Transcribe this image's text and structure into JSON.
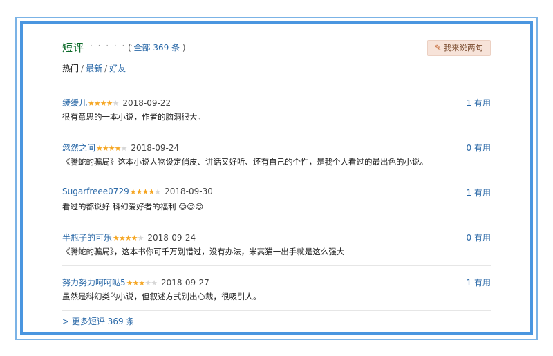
{
  "section": {
    "title": "短评",
    "dots": "· · · · · ·",
    "count_prefix": "( ",
    "count_link": "全部 369 条",
    "count_suffix": " )",
    "write_button": "我来说两句"
  },
  "tabs": [
    {
      "label": "热门"
    },
    {
      "label": "最新"
    },
    {
      "label": "好友"
    }
  ],
  "tab_separator": "/",
  "reviews": [
    {
      "user": "缓缓儿",
      "rating": 4,
      "date": "2018-09-22",
      "useful": "1 有用",
      "text": "很有意思的一本小说，作者的脑洞很大。"
    },
    {
      "user": "忽然之间",
      "rating": 4,
      "date": "2018-09-24",
      "useful": "0 有用",
      "text": "《腾蛇的骗局》这本小说人物设定俏皮、讲话又好听、还有自己的个性，是我个人看过的最出色的小说。"
    },
    {
      "user": "Sugarfreee0729",
      "rating": 4,
      "date": "2018-09-30",
      "useful": "1 有用",
      "text": "看过的都说好 科幻爱好者的福利 😊😊😊"
    },
    {
      "user": "半瓶子的可乐",
      "rating": 4,
      "date": "2018-09-24",
      "useful": "0 有用",
      "text": "《腾蛇的骗局》，这本书你可千万别错过，没有办法，米高猫一出手就是这么强大"
    },
    {
      "user": "努力努力呵呵哒5",
      "rating": 3,
      "date": "2018-09-27",
      "useful": "1 有用",
      "text": "虽然是科幻类的小说，但叙述方式别出心裁，很吸引人。"
    }
  ],
  "more_link": "> 更多短评 369 条",
  "colors": {
    "title": "#0d6b2a",
    "link": "#2c6aa8",
    "star_on": "#f5a623",
    "star_off": "#d6d6d6",
    "frame": "#4a96e0"
  }
}
